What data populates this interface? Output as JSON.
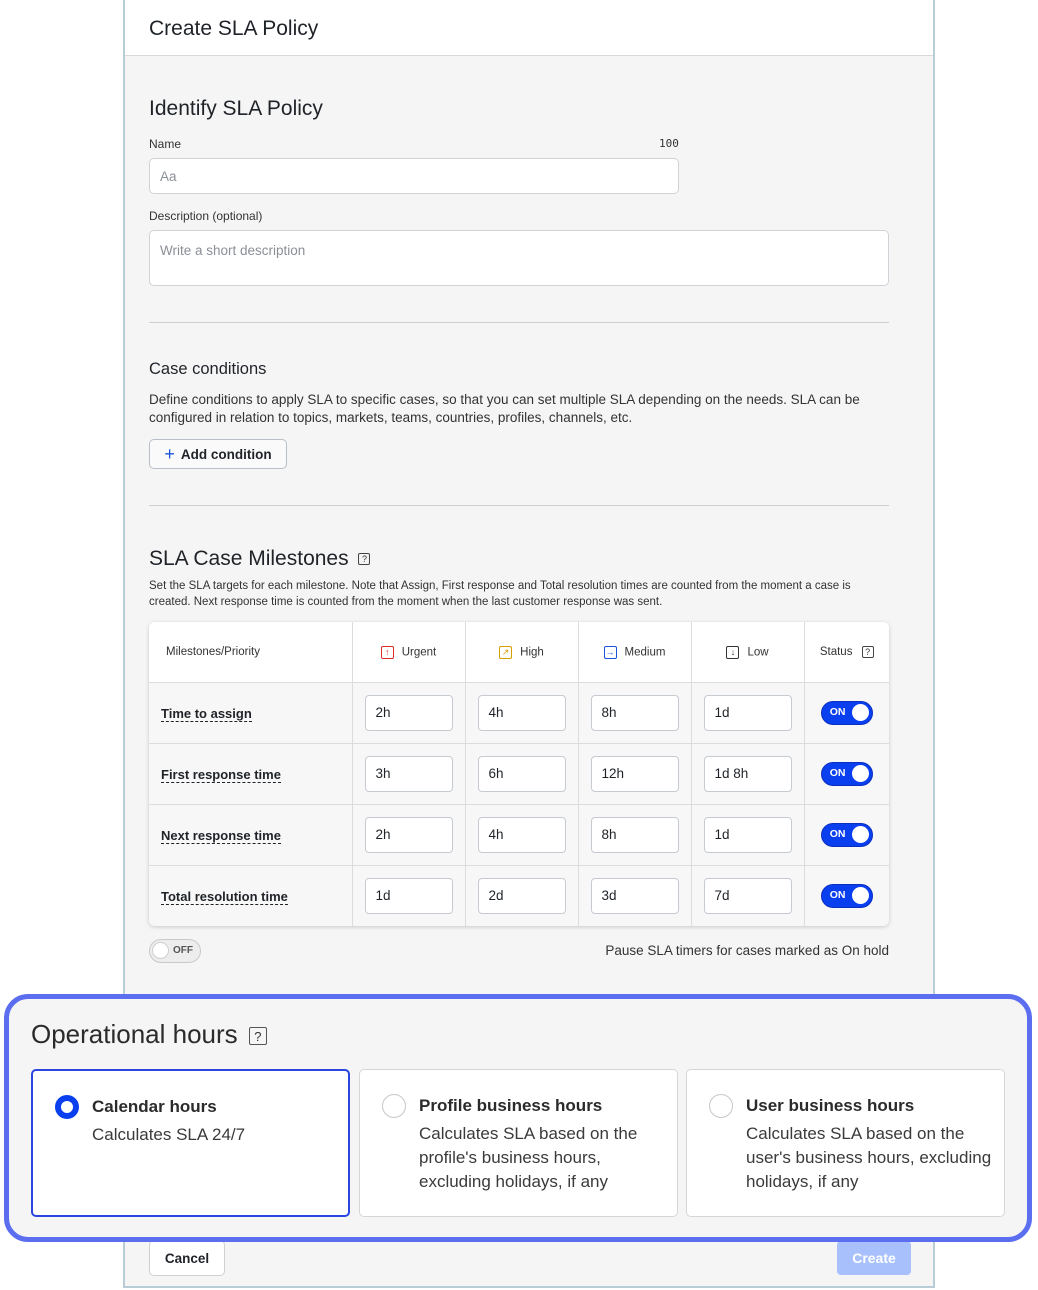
{
  "panel": {
    "title": "Create SLA Policy"
  },
  "identify": {
    "heading": "Identify SLA Policy",
    "name_label": "Name",
    "name_limit": "100",
    "name_placeholder": "Aa",
    "description_label": "Description (optional)",
    "description_placeholder": "Write a short description"
  },
  "conditions": {
    "heading": "Case conditions",
    "description": "Define conditions to apply SLA to specific cases, so that you can set multiple SLA depending on the needs. SLA can be configured in relation to topics, markets, teams, countries, profiles, channels, etc.",
    "add_label": "Add condition"
  },
  "milestones": {
    "heading": "SLA Case Milestones",
    "description": "Set the SLA targets for each milestone. Note that Assign, First response and Total resolution times are counted from the moment a case is created. Next response time is counted from the moment when the last customer response was sent.",
    "columns": {
      "milestone": "Milestones/Priority",
      "urgent": "Urgent",
      "high": "High",
      "medium": "Medium",
      "low": "Low",
      "status": "Status"
    },
    "priority_colors": {
      "urgent": "#d93025",
      "high": "#d69e00",
      "medium": "#1a56db",
      "low": "#333333"
    },
    "rows": [
      {
        "label": "Time to assign",
        "urgent": "2h",
        "high": "4h",
        "medium": "8h",
        "low": "1d",
        "status": "ON"
      },
      {
        "label": "First response time",
        "urgent": "3h",
        "high": "6h",
        "medium": "12h",
        "low": "1d 8h",
        "status": "ON"
      },
      {
        "label": "Next response time",
        "urgent": "2h",
        "high": "4h",
        "medium": "8h",
        "low": "1d",
        "status": "ON"
      },
      {
        "label": "Total resolution time",
        "urgent": "1d",
        "high": "2d",
        "medium": "3d",
        "low": "7d",
        "status": "ON"
      }
    ],
    "pause_toggle": "OFF",
    "pause_label": "Pause SLA timers for cases marked as On hold"
  },
  "operational": {
    "heading": "Operational hours",
    "options": [
      {
        "title": "Calendar hours",
        "description": "Calculates SLA 24/7",
        "selected": true
      },
      {
        "title": "Profile business hours",
        "description": "Calculates SLA based on the profile's business hours, excluding holidays, if any",
        "selected": false
      },
      {
        "title": "User business hours",
        "description": "Calculates SLA based on the user's business hours, excluding holidays, if any",
        "selected": false
      }
    ]
  },
  "footer": {
    "cancel_label": "Cancel",
    "create_label": "Create"
  },
  "colors": {
    "accent": "#0a3ff0",
    "callout_border": "#5b6ef0"
  }
}
